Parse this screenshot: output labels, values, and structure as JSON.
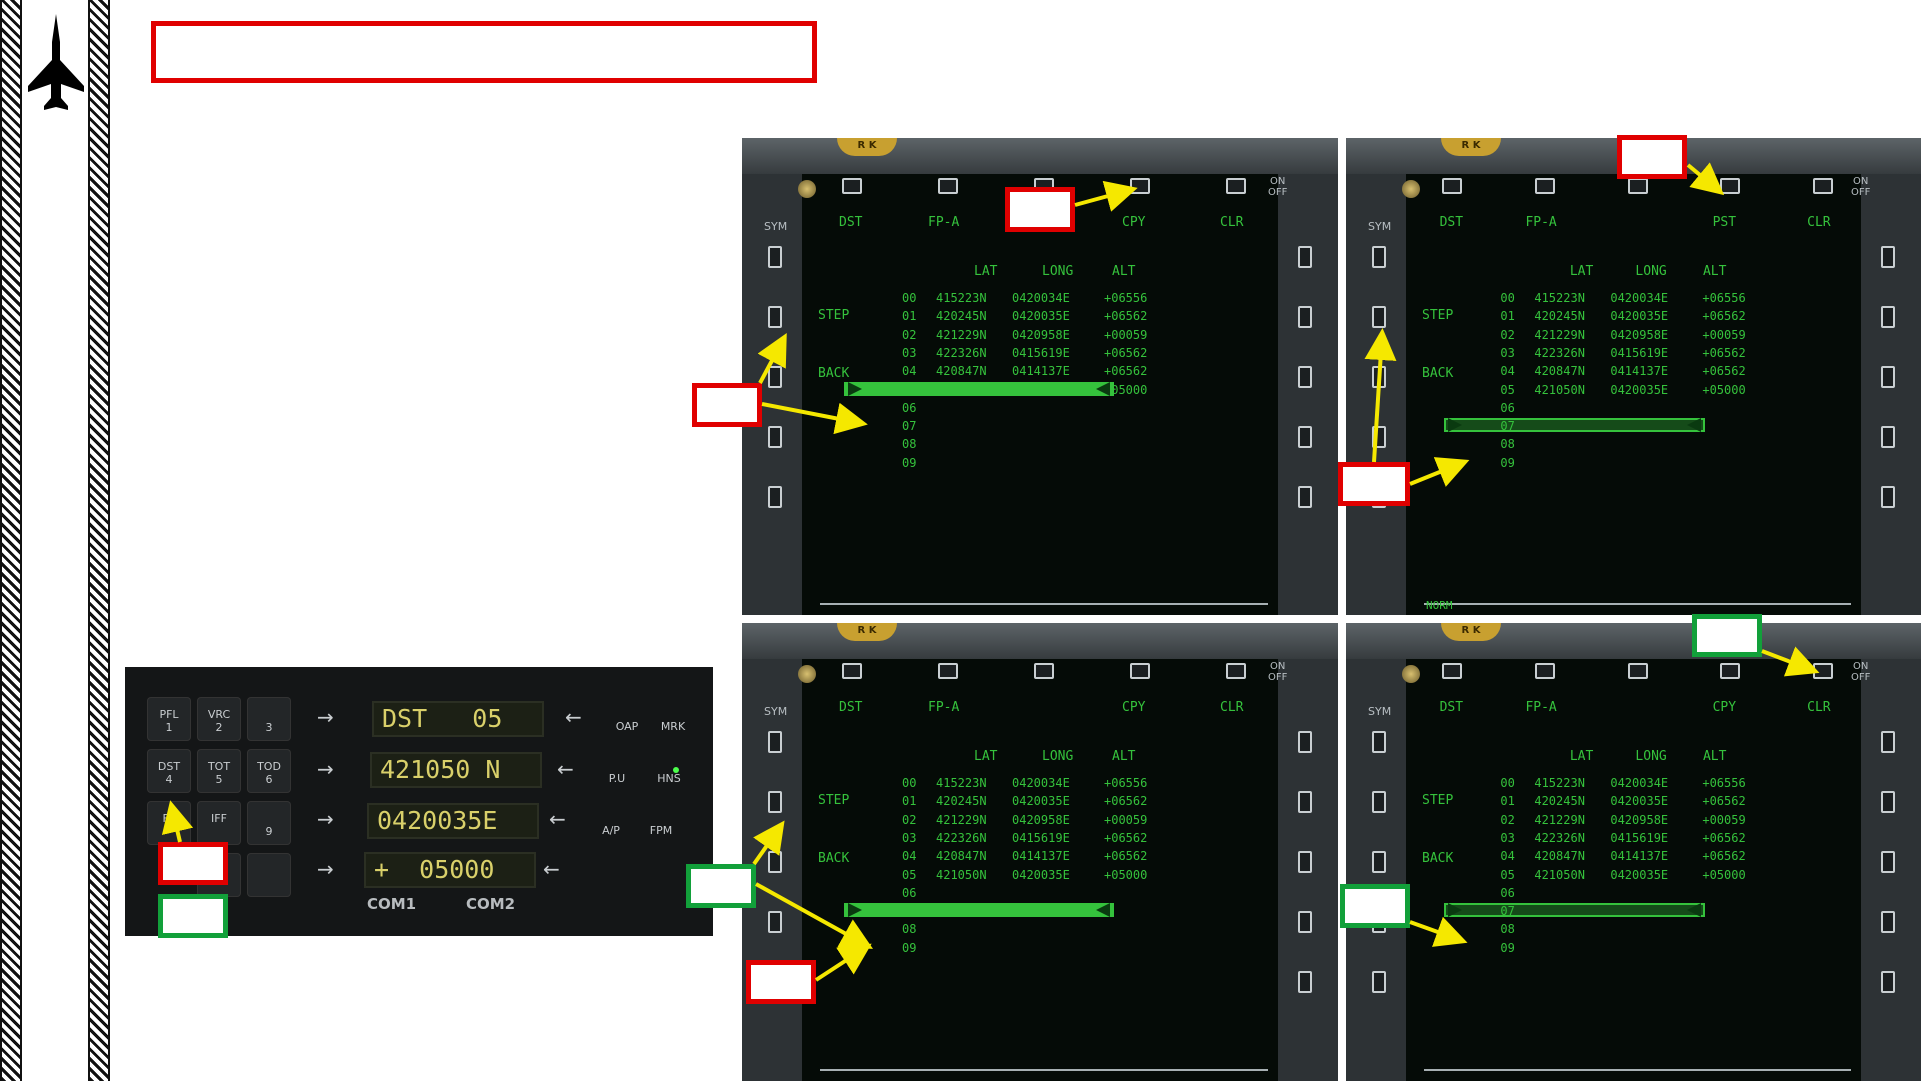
{
  "colors": {
    "callout_red": "#e00000",
    "callout_green": "#12a03a",
    "arrow": "#f5e800",
    "mfd_green": "#35c23c",
    "ufc_amber": "#d9d06a"
  },
  "title_box": "",
  "mfd": {
    "osb_top": [
      "DST",
      "FP-A",
      "CPY",
      "CLR"
    ],
    "osb_top_pst": [
      "DST",
      "FP-A",
      "PST",
      "CLR"
    ],
    "side_step": "STEP",
    "side_back": "BACK",
    "sym": "SYM",
    "on": "ON",
    "off": "OFF",
    "norm": "NORM",
    "brk": "R K",
    "columns": {
      "lat": "LAT",
      "long": "LONG",
      "alt": "ALT"
    },
    "rows": [
      {
        "n": "00",
        "lat": "415223N",
        "long": "0420034E",
        "alt": "+06556"
      },
      {
        "n": "01",
        "lat": "420245N",
        "long": "0420035E",
        "alt": "+06562"
      },
      {
        "n": "02",
        "lat": "421229N",
        "long": "0420958E",
        "alt": "+00059"
      },
      {
        "n": "03",
        "lat": "422326N",
        "long": "0415619E",
        "alt": "+06562"
      },
      {
        "n": "04",
        "lat": "420847N",
        "long": "0414137E",
        "alt": "+06562"
      },
      {
        "n": "05",
        "lat": "421050N",
        "long": "0420035E",
        "alt": "+05000"
      }
    ],
    "empty_rows": [
      "06",
      "07",
      "08",
      "09"
    ]
  },
  "ufc": {
    "keys": [
      {
        "l1": "PFL",
        "l2": "1"
      },
      {
        "l1": "VRC",
        "l2": "2"
      },
      {
        "l1": "",
        "l2": "3"
      },
      {
        "l1": "DST",
        "l2": "4"
      },
      {
        "l1": "TOT",
        "l2": "5"
      },
      {
        "l1": "TOD",
        "l2": "6"
      },
      {
        "l1": "FP",
        "l2": ""
      },
      {
        "l1": "IFF",
        "l2": ""
      },
      {
        "l1": "",
        "l2": "9"
      }
    ],
    "right_keys": [
      "OAP",
      "MRK",
      "P.U",
      "HNS",
      "A/P",
      "FPM"
    ],
    "display": [
      "DST   05",
      "421050 N",
      "0420035E",
      "+  05000"
    ],
    "com1": "COM1",
    "com2": "COM2"
  }
}
